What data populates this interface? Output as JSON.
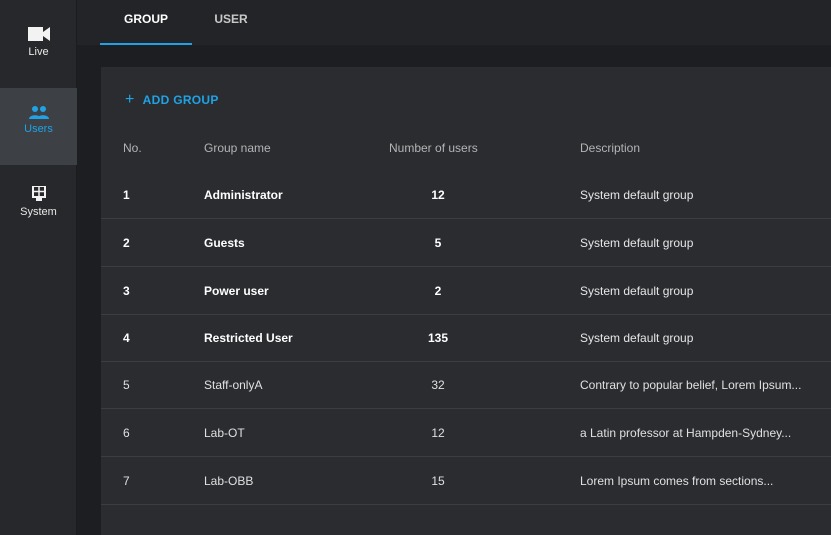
{
  "sidebar": {
    "items": [
      {
        "label": "Live",
        "icon": "video-camera-icon",
        "active": false
      },
      {
        "label": "Users",
        "icon": "users-icon",
        "active": true
      },
      {
        "label": "System",
        "icon": "system-icon",
        "active": false
      }
    ]
  },
  "tabs": [
    {
      "label": "GROUP",
      "active": true
    },
    {
      "label": "USER",
      "active": false
    }
  ],
  "toolbar": {
    "add_group_label": "ADD GROUP",
    "add_group_icon": "plus-icon"
  },
  "table": {
    "columns": [
      "No.",
      "Group name",
      "Number of users",
      "Description"
    ],
    "rows": [
      {
        "no": "1",
        "name": "Administrator",
        "count": "12",
        "description": "System default group",
        "bold": true
      },
      {
        "no": "2",
        "name": "Guests",
        "count": "5",
        "description": "System default group",
        "bold": true
      },
      {
        "no": "3",
        "name": "Power user",
        "count": "2",
        "description": "System default group",
        "bold": true
      },
      {
        "no": "4",
        "name": "Restricted User",
        "count": "135",
        "description": "System default group",
        "bold": true
      },
      {
        "no": "5",
        "name": "Staff-onlyA",
        "count": "32",
        "description": "Contrary to popular belief, Lorem Ipsum...",
        "bold": false
      },
      {
        "no": "6",
        "name": "Lab-OT",
        "count": "12",
        "description": "a Latin professor at Hampden-Sydney...",
        "bold": false
      },
      {
        "no": "7",
        "name": "Lab-OBB",
        "count": "15",
        "description": "Lorem Ipsum comes from sections...",
        "bold": false
      }
    ]
  },
  "colors": {
    "accent": "#1fa3e6",
    "sidebar_bg": "#26282b",
    "panel_bg": "#2a2c30",
    "page_bg": "#1c1e21"
  }
}
